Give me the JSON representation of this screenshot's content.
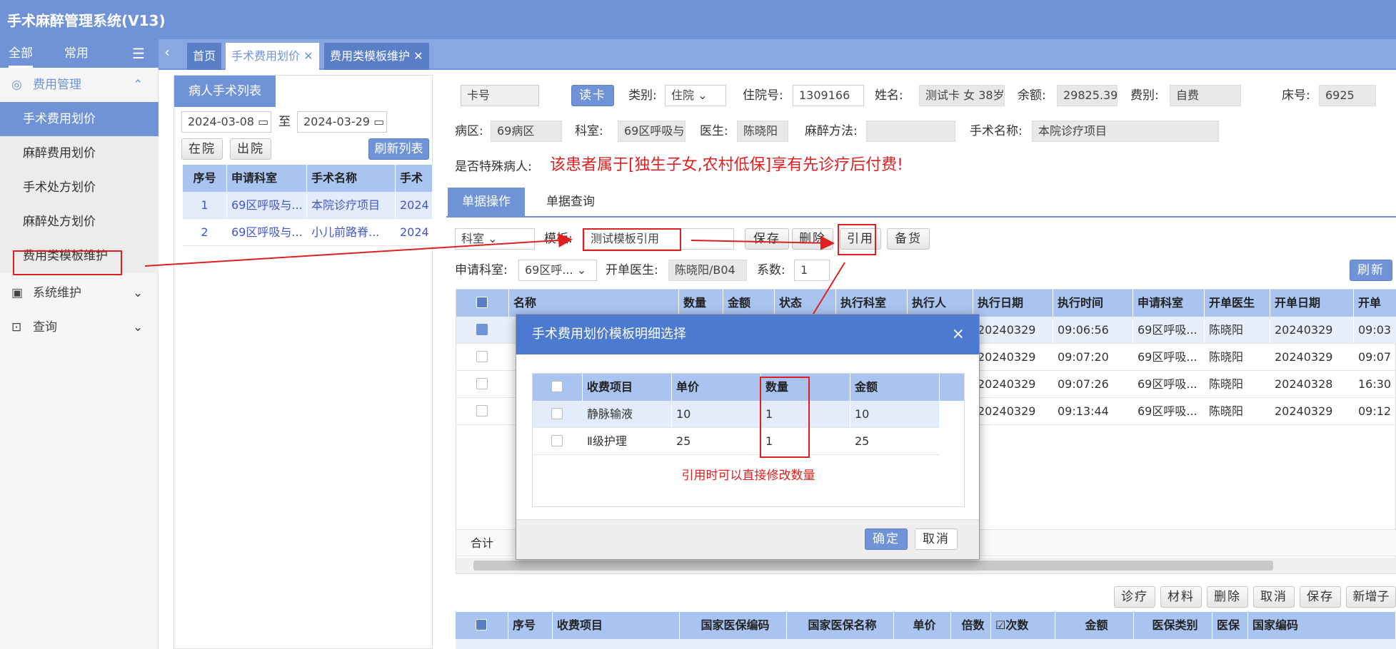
{
  "app": {
    "title": "手术麻醉管理系统(V13)"
  },
  "sidebar": {
    "tab_all": "全部",
    "tab_common": "常用",
    "group_fee": "费用管理",
    "group_sys": "系统维护",
    "group_query": "查询",
    "items": [
      {
        "label": "手术费用划价"
      },
      {
        "label": "麻醉费用划价"
      },
      {
        "label": "手术处方划价"
      },
      {
        "label": "麻醉处方划价"
      },
      {
        "label": "费用类模板维护"
      }
    ]
  },
  "tabs": [
    {
      "label": "首页"
    },
    {
      "label": "手术费用划价"
    },
    {
      "label": "费用类模板维护"
    }
  ],
  "left": {
    "title": "病人手术列表",
    "date_from": "2024-03-08",
    "to": "至",
    "date_to": "2024-03-29",
    "btn_in": "在院",
    "btn_out": "出院",
    "btn_refresh": "刷新列表",
    "headers": [
      "序号",
      "申请科室",
      "手术名称",
      "手术"
    ],
    "rows": [
      [
        "1",
        "69区呼吸与...",
        "本院诊疗项目",
        "2024"
      ],
      [
        "2",
        "69区呼吸与...",
        "小儿前路脊...",
        "2024"
      ]
    ]
  },
  "patient": {
    "card_lbl": "卡号",
    "read_card": "读卡",
    "type_lbl": "类别:",
    "type_val": "住院",
    "inpno_lbl": "住院号:",
    "inpno_val": "1309166",
    "name_lbl": "姓名:",
    "name_val": "测试卡",
    "sex": "女",
    "age": "38岁",
    "bal_lbl": "余额:",
    "bal_val": "29825.39",
    "feetype_lbl": "费别:",
    "feetype_val": "自费",
    "bed_lbl": "床号:",
    "bed_val": "6925",
    "ward_lbl": "病区:",
    "ward_val": "69病区",
    "dept_lbl": "科室:",
    "dept_val": "69区呼吸与",
    "doc_lbl": "医生:",
    "doc_val": "陈晓阳",
    "anes_lbl": "麻醉方法:",
    "anes_val": "",
    "op_lbl": "手术名称:",
    "op_val": "本院诊疗项目",
    "special_lbl": "是否特殊病人:",
    "special_msg": "该患者属于[独生子女,农村低保]享有先诊疗后付费!"
  },
  "ops": {
    "tab_doc": "单据操作",
    "tab_query": "单据查询",
    "dept_sel": "科室",
    "tpl_lbl": "模板:",
    "tpl_val": "测试模板引用",
    "btn_save": "保存",
    "btn_del": "删除",
    "btn_ref": "引用",
    "btn_stock": "备货",
    "reqdept_lbl": "申请科室:",
    "reqdept_val": "69区呼...",
    "doc_lbl": "开单医生:",
    "doc_val": "陈晓阳/B04",
    "coef_lbl": "系数:",
    "coef_val": "1",
    "btn_refresh": "刷新",
    "total": "合计"
  },
  "grid": {
    "headers": [
      "名称",
      "数量",
      "金额",
      "状态",
      "执行科室",
      "执行人",
      "执行日期",
      "执行时间",
      "申请科室",
      "开单医生",
      "开单日期",
      "开单"
    ],
    "rows": [
      {
        "date": "20240329",
        "time": "09:06:56",
        "dept": "69区呼吸...",
        "doc": "陈晓阳",
        "odate": "20240329",
        "otime": "09:03"
      },
      {
        "date": "20240329",
        "time": "09:07:20",
        "dept": "69区呼吸...",
        "doc": "陈晓阳",
        "odate": "20240329",
        "otime": "09:07"
      },
      {
        "date": "20240329",
        "time": "09:07:26",
        "dept": "69区呼吸...",
        "doc": "陈晓阳",
        "odate": "20240328",
        "otime": "16:30"
      },
      {
        "date": "20240329",
        "time": "09:13:44",
        "dept": "69区呼吸...",
        "doc": "陈晓阳",
        "odate": "20240329",
        "otime": "09:12"
      }
    ]
  },
  "bottom": {
    "btns": [
      "诊疗",
      "材料",
      "删除",
      "取消",
      "保存",
      "新增子"
    ],
    "headers": [
      "序号",
      "收费项目",
      "国家医保编码",
      "国家医保名称",
      "单价",
      "倍数",
      "次数",
      "金额",
      "医保类别",
      "医保",
      "国家编码"
    ]
  },
  "dialog": {
    "title": "手术费用划价模板明细选择",
    "close": "×",
    "headers": [
      "收费项目",
      "单价",
      "数量",
      "金额"
    ],
    "rows": [
      [
        "静脉输液",
        "10",
        "1",
        "10"
      ],
      [
        "Ⅱ级护理",
        "25",
        "1",
        "25"
      ]
    ],
    "note": "引用时可以直接修改数量",
    "ok": "确定",
    "cancel": "取消"
  },
  "colors": {
    "primary": "#6f93d6",
    "header": "#a9c4f0",
    "red": "#e02020"
  }
}
